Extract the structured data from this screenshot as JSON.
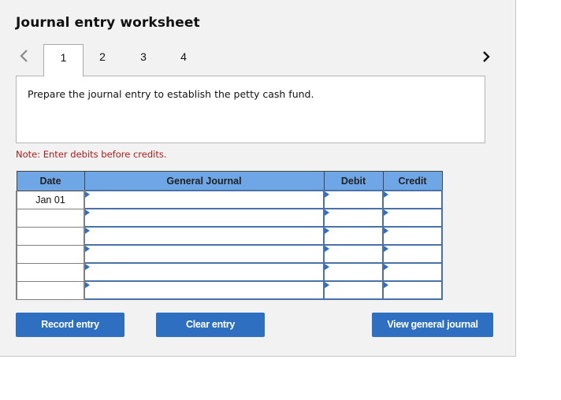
{
  "header": {
    "title": "Journal entry worksheet"
  },
  "pager": {
    "tabs": [
      {
        "label": "1",
        "active": true
      },
      {
        "label": "2"
      },
      {
        "label": "3"
      },
      {
        "label": "4"
      }
    ],
    "prev_icon": "chevron-left-icon",
    "next_icon": "chevron-right-icon"
  },
  "prompt": {
    "text": "Prepare the journal entry to establish the petty cash fund."
  },
  "note": {
    "text": "Note: Enter debits before credits."
  },
  "table": {
    "columns": [
      "Date",
      "General Journal",
      "Debit",
      "Credit"
    ],
    "rows": [
      {
        "date": "Jan 01",
        "account": "",
        "debit": "",
        "credit": ""
      },
      {
        "date": "",
        "account": "",
        "debit": "",
        "credit": ""
      },
      {
        "date": "",
        "account": "",
        "debit": "",
        "credit": ""
      },
      {
        "date": "",
        "account": "",
        "debit": "",
        "credit": ""
      },
      {
        "date": "",
        "account": "",
        "debit": "",
        "credit": ""
      },
      {
        "date": "",
        "account": "",
        "debit": "",
        "credit": ""
      }
    ]
  },
  "buttons": {
    "record": "Record entry",
    "clear": "Clear entry",
    "view": "View general journal"
  },
  "colors": {
    "header_bg": "#6fa6e6",
    "button_bg": "#2e6fc1",
    "note": "#b01c1c",
    "input_border": "#4a72a8"
  }
}
